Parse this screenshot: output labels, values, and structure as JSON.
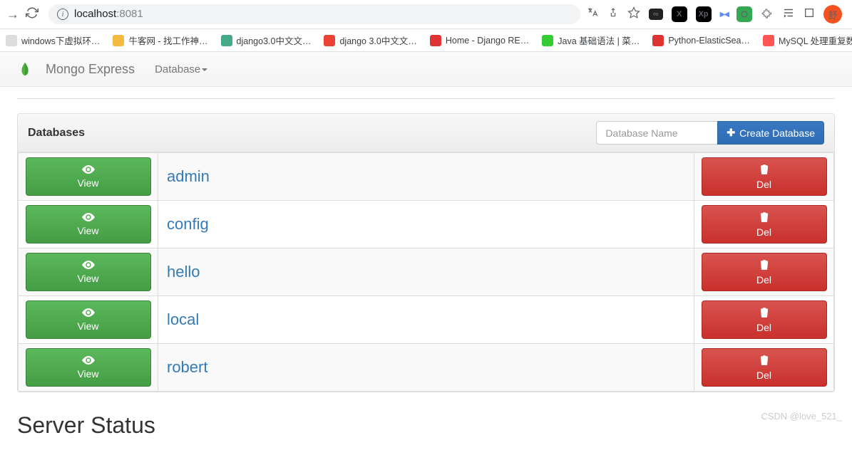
{
  "browser": {
    "url_host": "localhost",
    "url_port": ":8081",
    "avatar_label": "舒"
  },
  "bookmarks": [
    {
      "label": "windows下虚拟环…",
      "color": "#ddd"
    },
    {
      "label": "牛客网 - 找工作神…",
      "color": "#f5b942"
    },
    {
      "label": "django3.0中文文…",
      "color": "#4a8"
    },
    {
      "label": "django 3.0中文文…",
      "color": "#ea4335"
    },
    {
      "label": "Home - Django RE…",
      "color": "#d33"
    },
    {
      "label": "Java 基础语法 | 菜…",
      "color": "#3c3"
    },
    {
      "label": "Python-ElasticSea…",
      "color": "#d33"
    },
    {
      "label": "MySQL 处理重复数…",
      "color": "#f55"
    }
  ],
  "app": {
    "brand": "Mongo Express",
    "nav_item": "Database"
  },
  "panel": {
    "title": "Databases",
    "input_placeholder": "Database Name",
    "create_label": "Create Database",
    "view_label": "View",
    "del_label": "Del"
  },
  "databases": [
    {
      "name": "admin"
    },
    {
      "name": "config"
    },
    {
      "name": "hello"
    },
    {
      "name": "local"
    },
    {
      "name": "robert"
    }
  ],
  "status_heading": "Server Status",
  "watermark": "CSDN @love_521_"
}
